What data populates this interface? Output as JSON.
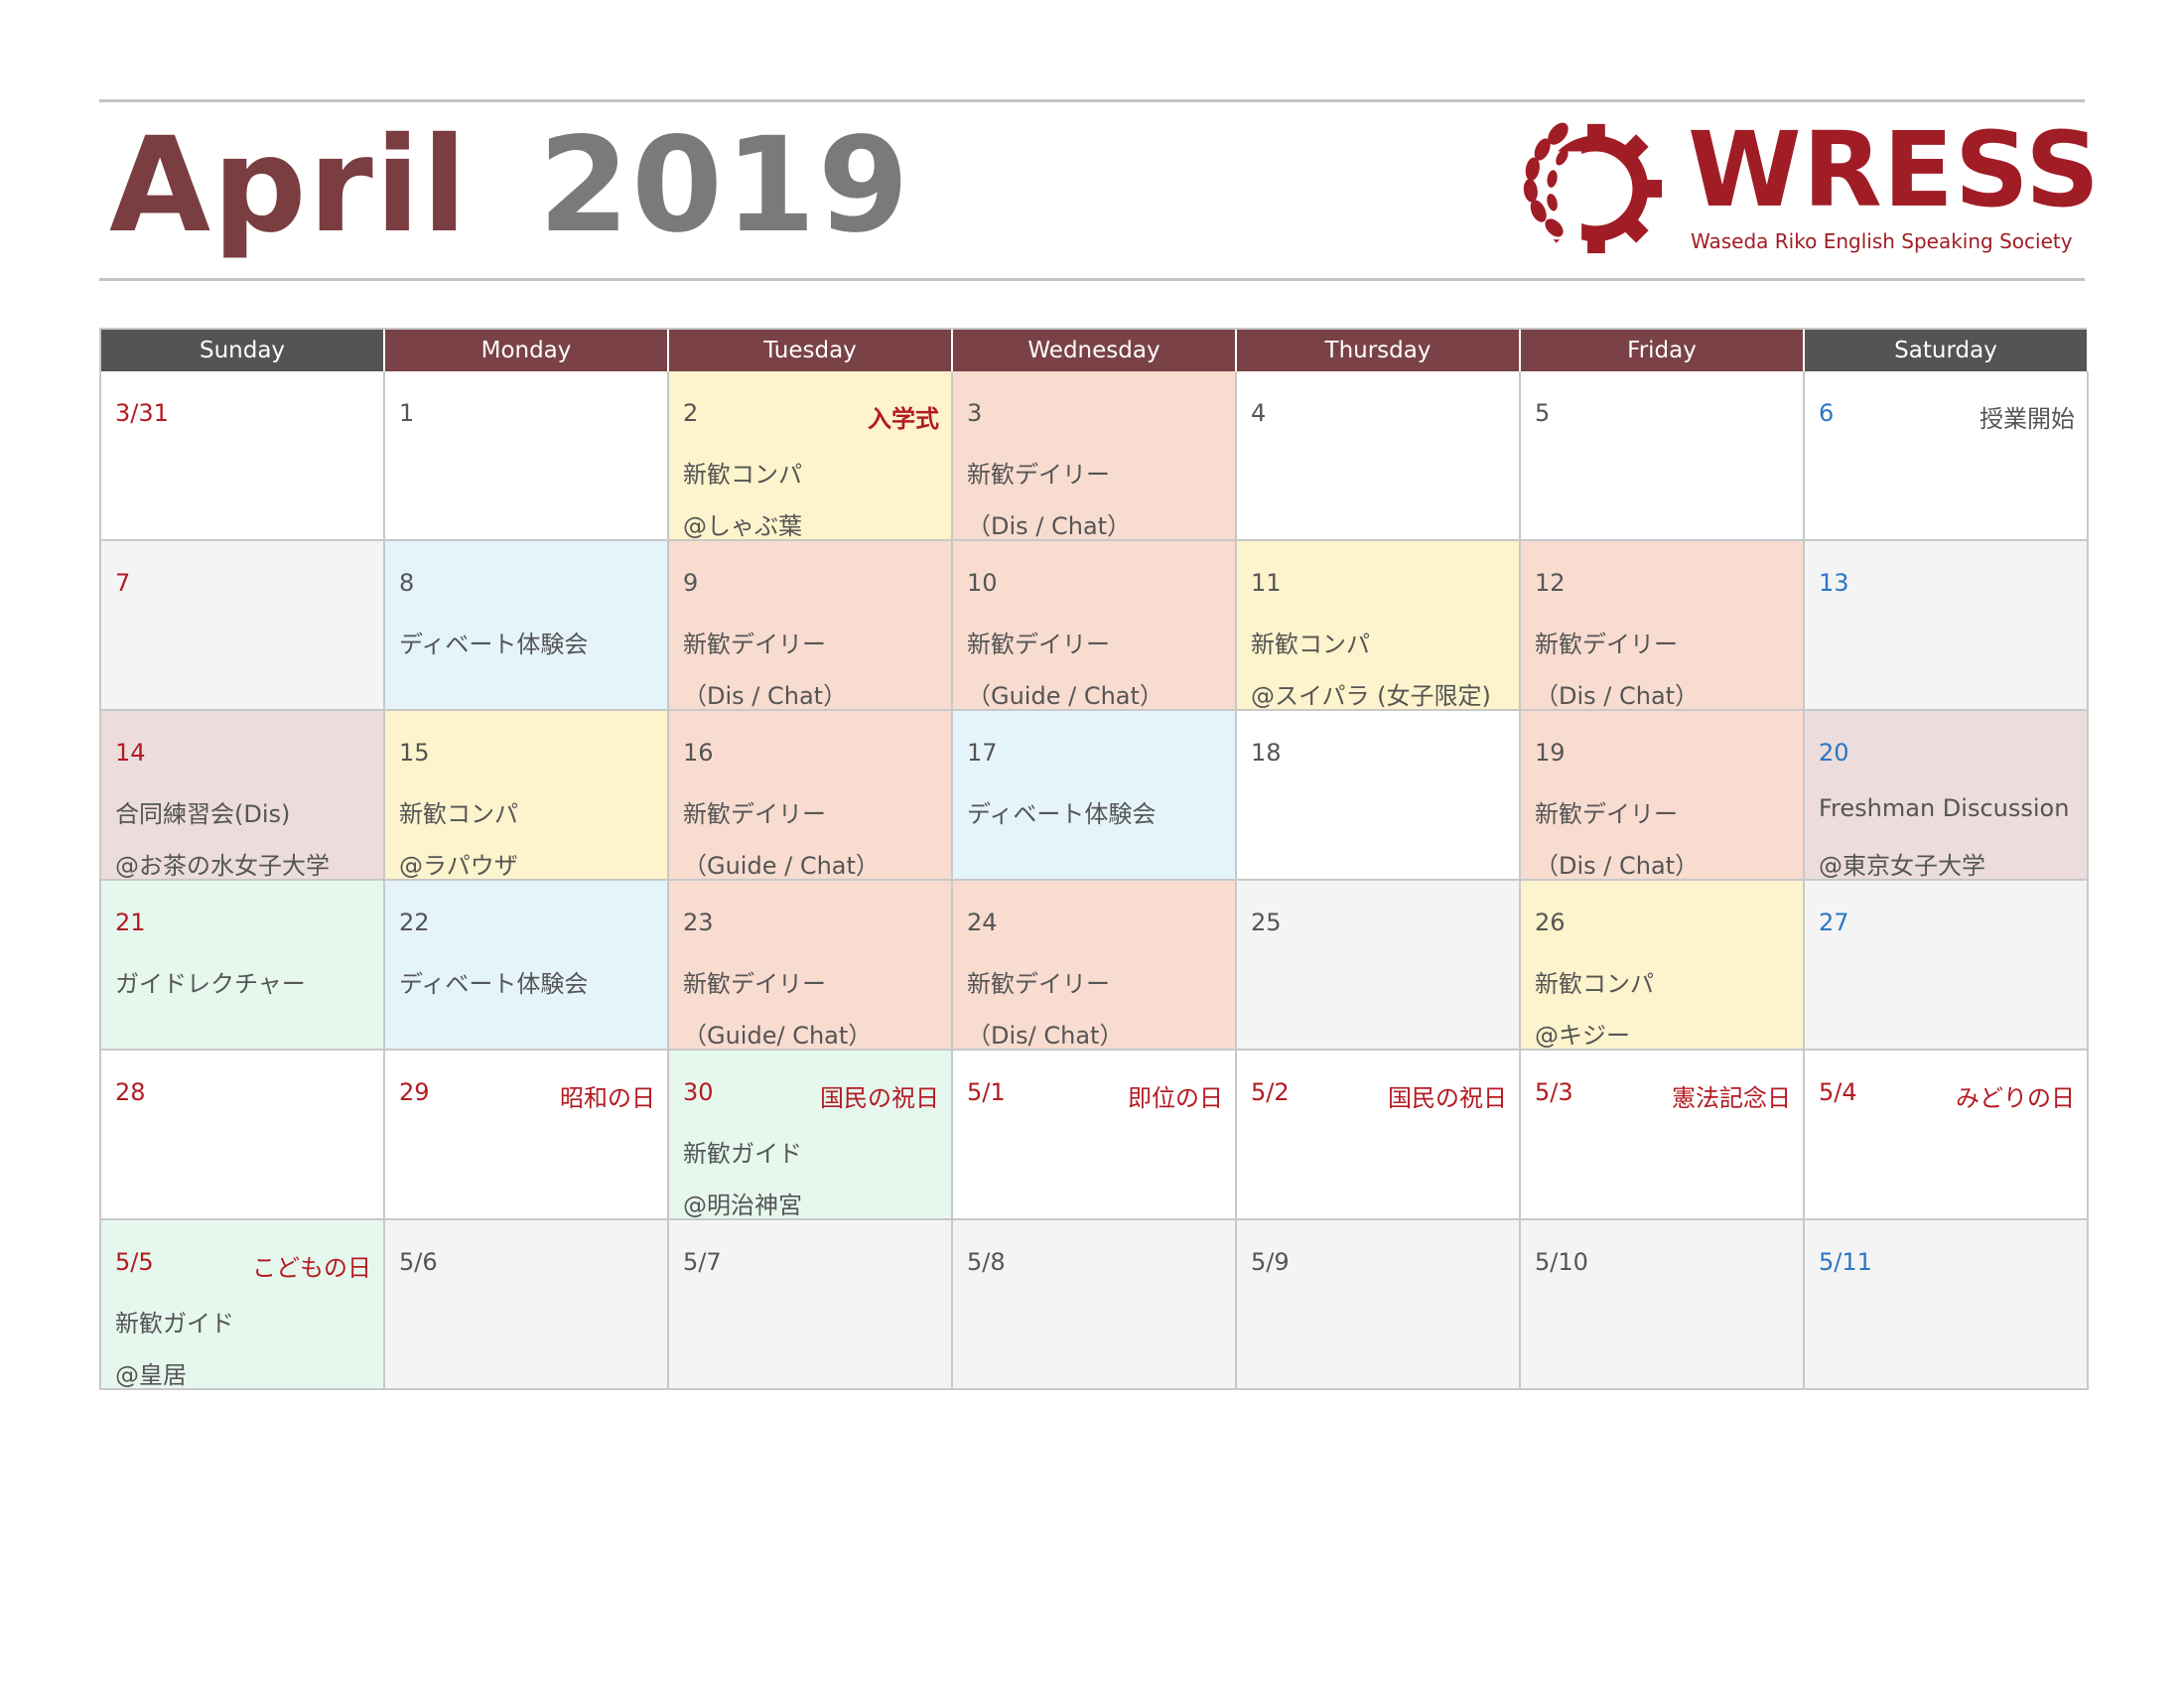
{
  "header": {
    "month": "April",
    "year": "2019"
  },
  "logo": {
    "wordmark": "WRESS",
    "tagline": "Waseda Riko English Speaking Society",
    "brand_color": "#a11d26"
  },
  "colors": {
    "month_title": "#7a3d40",
    "year_title": "#7a7a7a",
    "holiday_red": "#b31b22",
    "saturday_blue": "#2a76c6",
    "yellow": "#fdf3cc",
    "salmon": "#f8dcd0",
    "light_blue": "#e5f4fb",
    "mauve": "#ecdcdc",
    "mint": "#e6f7ee",
    "gray": "#f4f4f4"
  },
  "weekdays": [
    "Sunday",
    "Monday",
    "Tuesday",
    "Wednesday",
    "Thursday",
    "Friday",
    "Saturday"
  ],
  "weeks": [
    [
      {
        "date": "3/31",
        "date_color": "red",
        "bg": "white"
      },
      {
        "date": "1",
        "bg": "white"
      },
      {
        "date": "2",
        "bg": "yellow",
        "holiday": "入学式",
        "holiday_bold": true,
        "lines": [
          "新歓コンパ",
          "@しゃぶ葉"
        ]
      },
      {
        "date": "3",
        "bg": "salmon",
        "lines": [
          "新歓デイリー",
          "（Dis / Chat）"
        ]
      },
      {
        "date": "4",
        "bg": "white"
      },
      {
        "date": "5",
        "bg": "white"
      },
      {
        "date": "6",
        "date_color": "blue",
        "bg": "white",
        "holiday": "授業開始",
        "holiday_gray": true
      }
    ],
    [
      {
        "date": "7",
        "date_color": "red",
        "bg": "gray"
      },
      {
        "date": "8",
        "bg": "blue",
        "lines": [
          "ディベート体験会"
        ]
      },
      {
        "date": "9",
        "bg": "salmon",
        "lines": [
          "新歓デイリー",
          "（Dis / Chat）"
        ]
      },
      {
        "date": "10",
        "bg": "salmon",
        "lines": [
          "新歓デイリー",
          "（Guide / Chat）"
        ]
      },
      {
        "date": "11",
        "bg": "yellow",
        "lines": [
          "新歓コンパ",
          "@スイパラ (女子限定)"
        ]
      },
      {
        "date": "12",
        "bg": "salmon",
        "lines": [
          "新歓デイリー",
          "（Dis / Chat）"
        ]
      },
      {
        "date": "13",
        "date_color": "blue",
        "bg": "gray"
      }
    ],
    [
      {
        "date": "14",
        "date_color": "red",
        "bg": "mauve",
        "lines": [
          "合同練習会(Dis)",
          "@お茶の水女子大学"
        ]
      },
      {
        "date": "15",
        "bg": "yellow",
        "lines": [
          "新歓コンパ",
          "@ラパウザ"
        ]
      },
      {
        "date": "16",
        "bg": "salmon",
        "lines": [
          "新歓デイリー",
          "（Guide / Chat）"
        ]
      },
      {
        "date": "17",
        "bg": "blue",
        "lines": [
          "ディベート体験会"
        ]
      },
      {
        "date": "18",
        "bg": "white"
      },
      {
        "date": "19",
        "bg": "salmon",
        "lines": [
          "新歓デイリー",
          "（Dis / Chat）"
        ]
      },
      {
        "date": "20",
        "date_color": "blue",
        "bg": "mauve",
        "lines": [
          "Freshman Discussion",
          "@東京女子大学"
        ]
      }
    ],
    [
      {
        "date": "21",
        "date_color": "red",
        "bg": "green",
        "lines": [
          "ガイドレクチャー"
        ]
      },
      {
        "date": "22",
        "bg": "blue",
        "lines": [
          "ディベート体験会"
        ]
      },
      {
        "date": "23",
        "bg": "salmon",
        "lines": [
          "新歓デイリー",
          "（Guide/ Chat）"
        ]
      },
      {
        "date": "24",
        "bg": "salmon",
        "lines": [
          "新歓デイリー",
          "（Dis/ Chat）"
        ]
      },
      {
        "date": "25",
        "bg": "gray"
      },
      {
        "date": "26",
        "bg": "yellow",
        "lines": [
          "新歓コンパ",
          "@キジー"
        ]
      },
      {
        "date": "27",
        "date_color": "blue",
        "bg": "gray"
      }
    ],
    [
      {
        "date": "28",
        "date_color": "red",
        "bg": "white"
      },
      {
        "date": "29",
        "date_color": "red",
        "bg": "white",
        "holiday": "昭和の日"
      },
      {
        "date": "30",
        "date_color": "red",
        "bg": "green",
        "holiday": "国民の祝日",
        "lines": [
          "新歓ガイド",
          "@明治神宮"
        ]
      },
      {
        "date": "5/1",
        "date_color": "red",
        "bg": "white",
        "holiday": "即位の日"
      },
      {
        "date": "5/2",
        "date_color": "red",
        "bg": "white",
        "holiday": "国民の祝日"
      },
      {
        "date": "5/3",
        "date_color": "red",
        "bg": "white",
        "holiday": "憲法記念日"
      },
      {
        "date": "5/4",
        "date_color": "red",
        "bg": "white",
        "holiday": "みどりの日"
      }
    ],
    [
      {
        "date": "5/5",
        "date_color": "red",
        "bg": "green",
        "holiday": "こどもの日",
        "lines": [
          "新歓ガイド",
          "@皇居"
        ]
      },
      {
        "date": "5/6",
        "bg": "gray"
      },
      {
        "date": "5/7",
        "bg": "gray"
      },
      {
        "date": "5/8",
        "bg": "gray"
      },
      {
        "date": "5/9",
        "bg": "gray"
      },
      {
        "date": "5/10",
        "bg": "gray"
      },
      {
        "date": "5/11",
        "date_color": "blue",
        "bg": "gray"
      }
    ]
  ]
}
